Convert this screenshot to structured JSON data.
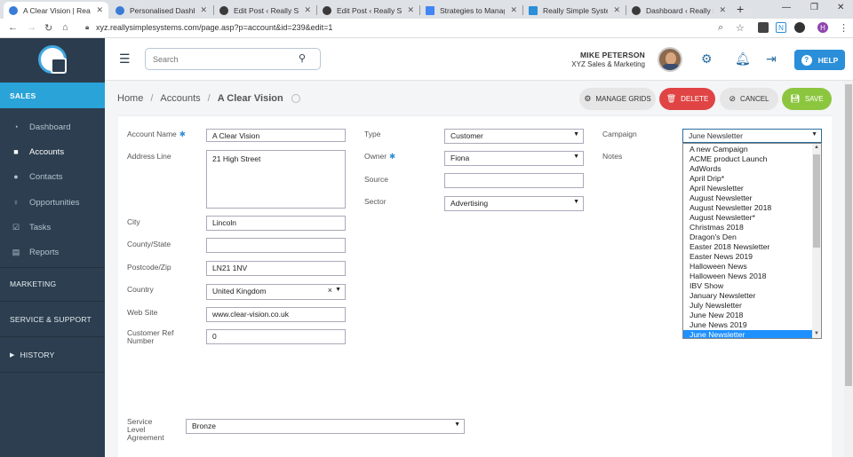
{
  "browser": {
    "tabs": [
      {
        "title": "A Clear Vision | Really S",
        "fav_color": "#3a7bd5",
        "active": true
      },
      {
        "title": "Personalised Dashboar",
        "fav_color": "#3a7bd5"
      },
      {
        "title": "Edit Post ‹ Really Simpl",
        "fav_color": "#3a3a3a"
      },
      {
        "title": "Edit Post ‹ Really Simpl",
        "fav_color": "#3a3a3a"
      },
      {
        "title": "Strategies to Manage a",
        "fav_color": "#4285f4"
      },
      {
        "title": "Really Simple Systems",
        "fav_color": "#2b8ed8"
      },
      {
        "title": "Dashboard ‹ Really Sim",
        "fav_color": "#3a3a3a"
      }
    ],
    "url": "xyz.reallysimplesystems.com/page.asp?p=account&id=239&edit=1",
    "profile_initial": "H",
    "ext_n_label": "N"
  },
  "sidebar": {
    "sales_label": "SALES",
    "items": [
      {
        "label": "Dashboard",
        "icon": "dashboard-icon"
      },
      {
        "label": "Accounts",
        "icon": "briefcase-icon",
        "active": true
      },
      {
        "label": "Contacts",
        "icon": "contacts-icon"
      },
      {
        "label": "Opportunities",
        "icon": "lightbulb-icon"
      },
      {
        "label": "Tasks",
        "icon": "checkbox-icon"
      },
      {
        "label": "Reports",
        "icon": "report-icon"
      }
    ],
    "marketing_label": "MARKETING",
    "service_label": "SERVICE & SUPPORT",
    "history_label": "HISTORY"
  },
  "header": {
    "search_placeholder": "Search",
    "user_name": "MIKE PETERSON",
    "user_org": "XYZ Sales & Marketing",
    "help_label": "HELP"
  },
  "breadcrumb": {
    "home": "Home",
    "accounts": "Accounts",
    "current": "A Clear Vision"
  },
  "toolbar": {
    "manage_label": "MANAGE GRIDS",
    "delete_label": "DELETE",
    "cancel_label": "CANCEL",
    "save_label": "SAVE"
  },
  "form": {
    "account_name_label": "Account Name",
    "account_name": "A Clear Vision",
    "address_label": "Address Line",
    "address": "21 High Street",
    "city_label": "City",
    "city": "Lincoln",
    "county_label": "County/State",
    "county": "",
    "postcode_label": "Postcode/Zip",
    "postcode": "LN21 1NV",
    "country_label": "Country",
    "country": "United Kingdom",
    "website_label": "Web Site",
    "website": "www.clear-vision.co.uk",
    "custref_label1": "Customer Ref",
    "custref_label2": "Number",
    "custref": "0",
    "type_label": "Type",
    "type": "Customer",
    "owner_label": "Owner",
    "owner": "Fiona",
    "source_label": "Source",
    "source": "",
    "sector_label": "Sector",
    "sector": "Advertising",
    "campaign_label": "Campaign",
    "campaign": "June Newsletter",
    "notes_label": "Notes",
    "sla_label1": "Service",
    "sla_label2": "Level",
    "sla_label3": "Agreement",
    "sla": "Bronze"
  },
  "campaign_options": [
    "A new Campaign",
    "ACME product Launch",
    "AdWords",
    "April Drip*",
    "April Newsletter",
    "August Newsletter",
    "August Newsletter 2018",
    "August Newsletter*",
    "Christmas 2018",
    "Dragon's Den",
    "Easter 2018 Newsletter",
    "Easter News 2019",
    "Halloween News",
    "Halloween News 2018",
    "IBV Show",
    "January Newsletter",
    "July Newsletter",
    "June New 2018",
    "June News 2019",
    "June Newsletter"
  ],
  "campaign_selected": "June Newsletter"
}
